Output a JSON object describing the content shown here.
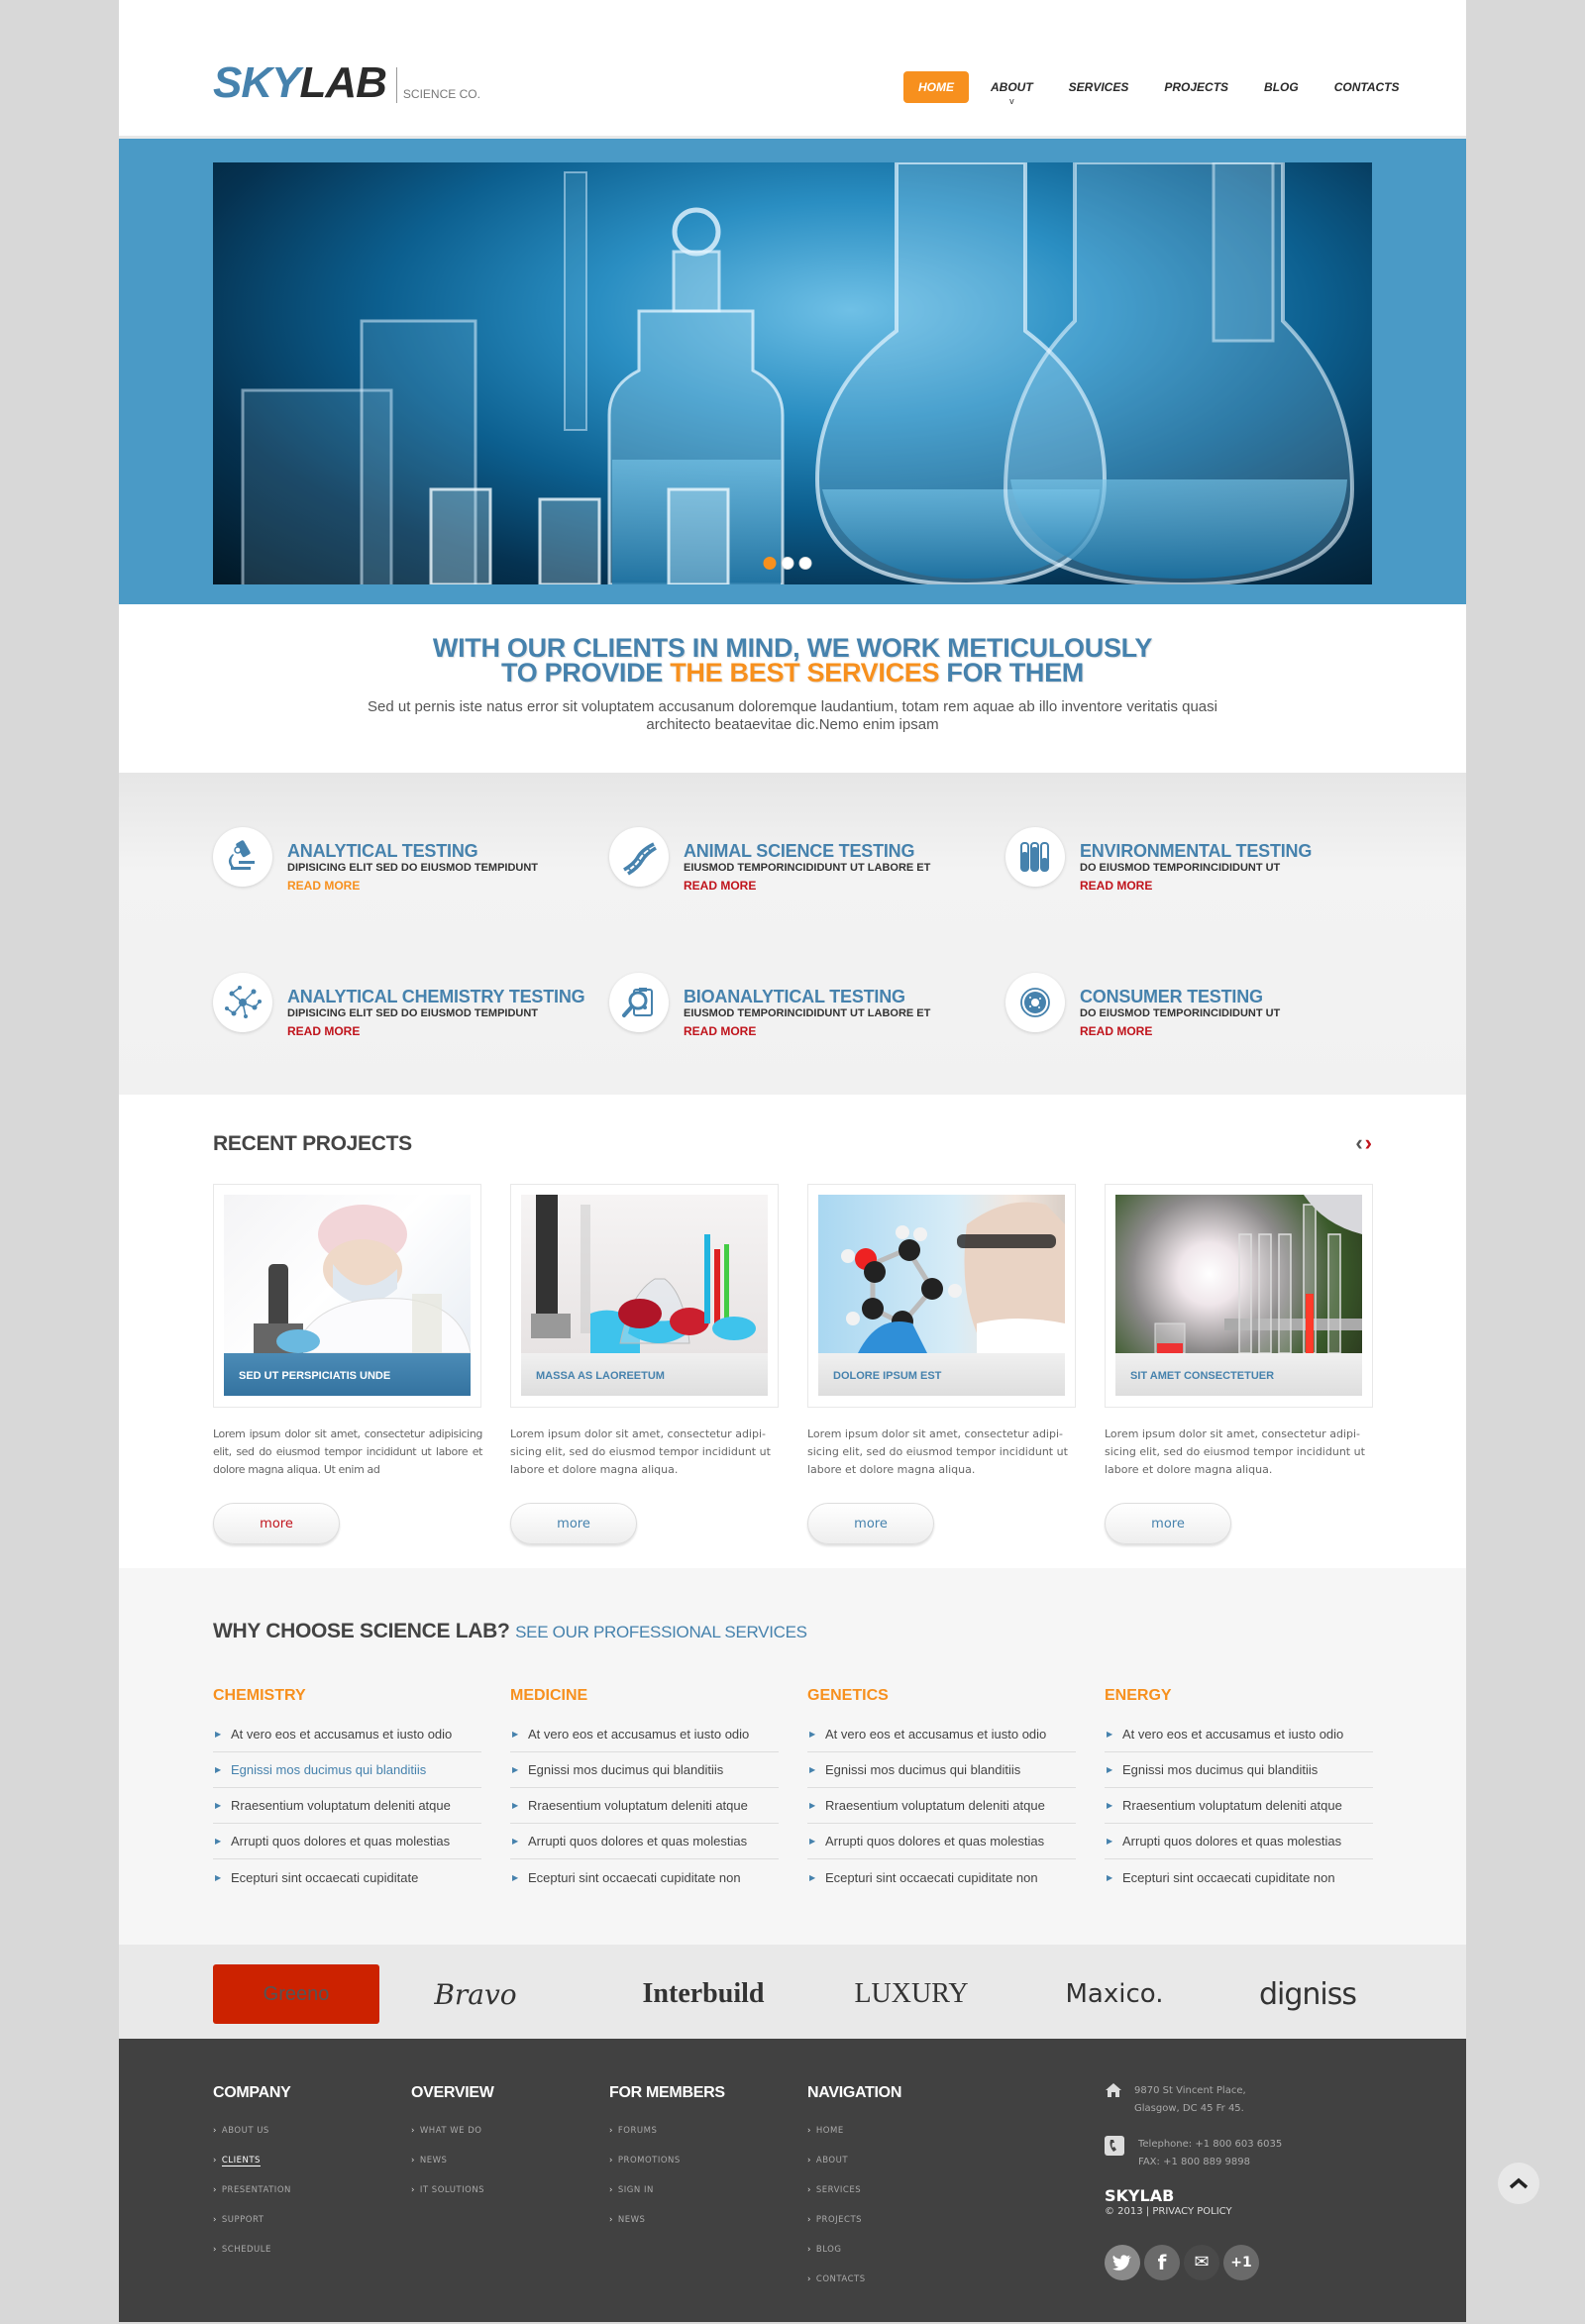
{
  "header": {
    "logo_primary": "SKY",
    "logo_secondary": "LAB",
    "logo_tagline": "SCIENCE CO.",
    "nav": [
      {
        "label": "HOME",
        "active": true
      },
      {
        "label": "ABOUT",
        "has_dropdown": true,
        "caret": "v"
      },
      {
        "label": "SERVICES"
      },
      {
        "label": "PROJECTS"
      },
      {
        "label": "BLOG"
      },
      {
        "label": "CONTACTS"
      }
    ]
  },
  "hero": {
    "image_alt": "laboratory glassware",
    "slides_count": 3,
    "active_slide": 1
  },
  "intro": {
    "headline_line1": "WITH OUR CLIENTS IN MIND, WE WORK METICULOUSLY",
    "headline_line2_pre": "TO PROVIDE ",
    "headline_line2_highlight": "THE BEST SERVICES",
    "headline_line2_post": " FOR THEM",
    "body": "Sed ut pernis iste natus error sit voluptatem accusanum doloremque laudantium, totam rem aquae ab illo inventore veritatis quasi architecto beataevitae dic.Nemo enim ipsam"
  },
  "services": [
    {
      "title": "ANALYTICAL TESTING",
      "subtitle": "DIPISICING ELIT SED DO EIUSMOD TEMPIDUNT",
      "link": "READ MORE",
      "icon": "microscope-icon",
      "link_color": "#f7901e"
    },
    {
      "title": "ANIMAL SCIENCE TESTING",
      "subtitle": "EIUSMOD TEMPORINCIDIDUNT UT LABORE ET",
      "link": "READ MORE",
      "icon": "dna-icon",
      "link_color": "#c0141c"
    },
    {
      "title": "ENVIRONMENTAL TESTING",
      "subtitle": "DO EIUSMOD TEMPORINCIDIDUNT UT",
      "link": "READ MORE",
      "icon": "test-tubes-icon",
      "link_color": "#c0141c"
    },
    {
      "title": "ANALYTICAL CHEMISTRY TESTING",
      "subtitle": "DIPISICING ELIT SED DO EIUSMOD TEMPIDUNT",
      "link": "READ MORE",
      "icon": "molecule-icon",
      "link_color": "#c0141c"
    },
    {
      "title": "BIOANALYTICAL TESTING",
      "subtitle": "EIUSMOD TEMPORINCIDIDUNT UT LABORE ET",
      "link": "READ MORE",
      "icon": "magnifier-clipboard-icon",
      "link_color": "#c0141c"
    },
    {
      "title": "CONSUMER TESTING",
      "subtitle": "DO EIUSMOD TEMPORINCIDIDUNT UT",
      "link": "READ MORE",
      "icon": "petri-dish-icon",
      "link_color": "#c0141c"
    }
  ],
  "projects": {
    "title": "RECENT PROJECTS",
    "prev_icon": "‹",
    "next_icon": "›",
    "items": [
      {
        "caption": "SED UT PERSPICIATIS UNDE",
        "text": "Lorem ipsum dolor sit amet, consectetur adipisicing elit, sed do eiusmod tempor incididunt ut labore et dolore magna aliqua. Ut enim ad",
        "button": "more",
        "active": true
      },
      {
        "caption": "MASSA AS LAOREETUM",
        "text": "Lorem ipsum dolor sit amet, consectetur adipi-sicing elit, sed do eiusmod tempor incididunt ut labore et dolore magna aliqua.",
        "button": "more"
      },
      {
        "caption": "DOLORE IPSUM EST",
        "text": "Lorem ipsum dolor sit amet, consectetur adipi-sicing elit, sed do eiusmod tempor incididunt ut labore et dolore magna aliqua.",
        "button": "more"
      },
      {
        "caption": "SIT AMET CONSECTETUER",
        "text": "Lorem ipsum dolor sit amet, consectetur adipi-sicing elit, sed do eiusmod tempor incididunt ut labore et dolore magna aliqua.",
        "button": "more"
      }
    ]
  },
  "why": {
    "title": "WHY CHOOSE SCIENCE LAB?",
    "subtitle": "SEE OUR PROFESSIONAL SERVICES",
    "columns": [
      {
        "heading": "CHEMISTRY",
        "items": [
          "At vero eos et accusamus et iusto odio",
          "Egnissi mos ducimus qui blanditiis",
          "Rraesentium voluptatum deleniti atque",
          "Arrupti quos dolores et quas molestias",
          "Ecepturi sint occaecati cupiditate"
        ],
        "highlighted_index": 1
      },
      {
        "heading": "MEDICINE",
        "items": [
          "At vero eos et accusamus et iusto odio",
          "Egnissi mos ducimus qui blanditiis",
          "Rraesentium voluptatum deleniti atque",
          "Arrupti quos dolores et quas molestias",
          "Ecepturi sint occaecati cupiditate non"
        ]
      },
      {
        "heading": "GENETICS",
        "items": [
          "At vero eos et accusamus et iusto odio",
          "Egnissi mos ducimus qui blanditiis",
          "Rraesentium voluptatum deleniti atque",
          "Arrupti quos dolores et quas molestias",
          "Ecepturi sint occaecati cupiditate non"
        ]
      },
      {
        "heading": "ENERGY",
        "items": [
          "At vero eos et accusamus et iusto odio",
          "Egnissi mos ducimus qui blanditiis",
          "Rraesentium voluptatum deleniti atque",
          "Arrupti quos dolores et quas molestias",
          "Ecepturi sint occaecati cupiditate non"
        ]
      }
    ]
  },
  "brands": [
    "Greeno",
    "Bravo",
    "Interbuild",
    "LUXURY",
    "Maxico.",
    "digniss"
  ],
  "footer": {
    "columns": [
      {
        "heading": "COMPANY",
        "links": [
          "ABOUT US",
          "CLIENTS",
          "PRESENTATION",
          "SUPPORT",
          "SCHEDULE"
        ],
        "active_index": 1
      },
      {
        "heading": "OVERVIEW",
        "links": [
          "WHAT WE DO",
          "NEWS",
          "IT SOLUTIONS"
        ]
      },
      {
        "heading": "FOR MEMBERS",
        "links": [
          "FORUMS",
          "PROMOTIONS",
          "SIGN IN",
          "NEWS"
        ]
      },
      {
        "heading": "NAVIGATION",
        "links": [
          "HOME",
          "ABOUT",
          "SERVICES",
          "PROJECTS",
          "BLOG",
          "CONTACTS"
        ]
      }
    ],
    "address_line1": "9870 St Vincent Place,",
    "address_line2": "Glasgow, DC 45 Fr 45.",
    "telephone": "Telephone:  +1 800 603 6035",
    "fax": "FAX: +1 800 889 9898",
    "brand": "SKYLAB",
    "copyright": "© 2013",
    "privacy": "PRIVACY POLICY",
    "socials": [
      {
        "name": "twitter",
        "glyph": "🐦"
      },
      {
        "name": "facebook",
        "glyph": "f"
      },
      {
        "name": "email",
        "glyph": "✉"
      },
      {
        "name": "google-plus",
        "glyph": "+1"
      }
    ]
  },
  "back_to_top": "^",
  "colors": {
    "brand_blue": "#4682ad",
    "accent_orange": "#f7901e",
    "accent_red": "#c0141c",
    "hero_band": "#4a9ac6",
    "footer_bg": "#414141"
  }
}
